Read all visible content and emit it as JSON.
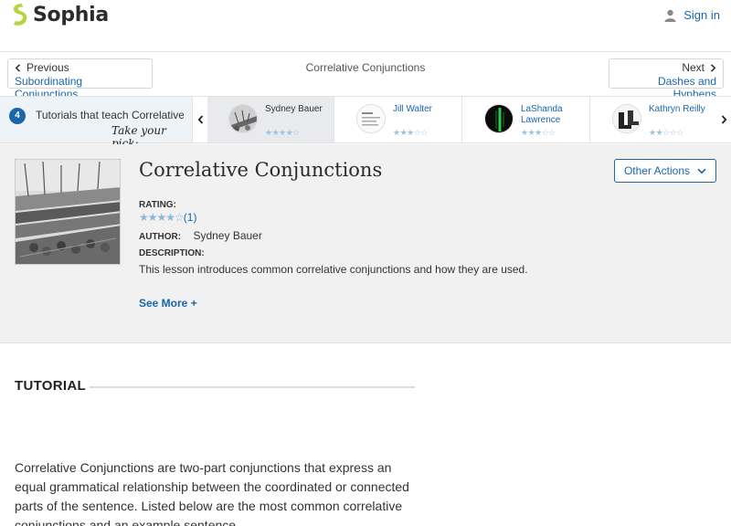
{
  "brand": {
    "name": "Sophia",
    "accent": "#1a66a8",
    "logo_color": "#b5d33d"
  },
  "header": {
    "signin_label": "Sign in",
    "user_icon": "user-icon"
  },
  "navigation": {
    "prev_small": "Previous",
    "prev_title": "Subordinating Conjunctions",
    "current_title": "Correlative Conjunctions",
    "next_small": "Next",
    "next_title": "Dashes and Hyphens"
  },
  "tutorials_strip": {
    "count": "4",
    "label": "Tutorials that teach Correlative Conjunctions",
    "pick_text": "Take your pick:",
    "cards": [
      {
        "author": "Sydney Bauer",
        "rating": 3.5,
        "active": true
      },
      {
        "author": "Jill Walter",
        "rating": 3,
        "active": false
      },
      {
        "author": "LaShanda Lawrence",
        "rating": 2.5,
        "active": false
      },
      {
        "author": "Kathryn Reilly",
        "rating": 1.5,
        "active": false
      }
    ]
  },
  "lesson": {
    "title": "Correlative Conjunctions",
    "other_actions": "Other Actions",
    "rating_label": "RATING:",
    "rating_value": 4.5,
    "rating_count": "(1)",
    "author_label": "AUTHOR:",
    "author": "Sydney Bauer",
    "description_label": "DESCRIPTION:",
    "description": "This lesson introduces common correlative conjunctions and how they are used.",
    "see_more": "See More +"
  },
  "tutorial": {
    "heading": "TUTORIAL",
    "body": "Correlative Conjunctions are two-part conjunctions that express an equal grammatical relationship between the coordinated or connected parts of the sentence. Listed below are the most common correlative conjunctions and an example sentence."
  }
}
